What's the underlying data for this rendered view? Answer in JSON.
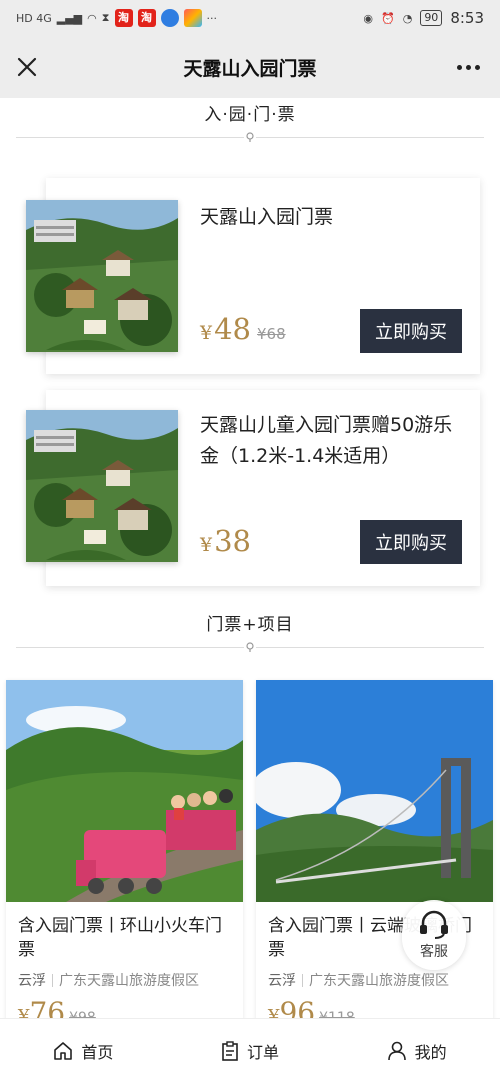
{
  "status_bar": {
    "left_text": "HD 4G",
    "apps": [
      "淘",
      "淘"
    ],
    "battery": "90",
    "time": "8:53"
  },
  "header": {
    "title": "天露山入园门票",
    "close_icon": "close-icon",
    "more_icon": "more-icon"
  },
  "sections": {
    "entrance_title": "入·园·门·票",
    "combo_title": "门票+项目"
  },
  "tickets": [
    {
      "name": "天露山入园门票",
      "currency": "¥",
      "price": "48",
      "original_price": "¥68",
      "buy_label": "立即购买"
    },
    {
      "name": "天露山儿童入园门票赠50游乐金（1.2米-1.4米适用）",
      "currency": "¥",
      "price": "38",
      "original_price": "",
      "buy_label": "立即购买"
    }
  ],
  "combos": [
    {
      "name": "含入园门票丨环山小火车门票",
      "city": "云浮",
      "venue": "广东天露山旅游度假区",
      "currency": "¥",
      "price": "76",
      "original_price": "¥98"
    },
    {
      "name": "含入园门票丨云端玻璃桥门票",
      "city": "云浮",
      "venue": "广东天露山旅游度假区",
      "currency": "¥",
      "price": "96",
      "original_price": "¥118"
    }
  ],
  "service": {
    "label": "客服",
    "icon": "headset-icon"
  },
  "nav": [
    {
      "label": "首页",
      "icon": "home-icon"
    },
    {
      "label": "订单",
      "icon": "order-icon"
    },
    {
      "label": "我的",
      "icon": "user-icon"
    }
  ],
  "colors": {
    "price_gold": "#b08a4a",
    "button_dark": "#2a3140",
    "header_bg": "#ededed"
  }
}
